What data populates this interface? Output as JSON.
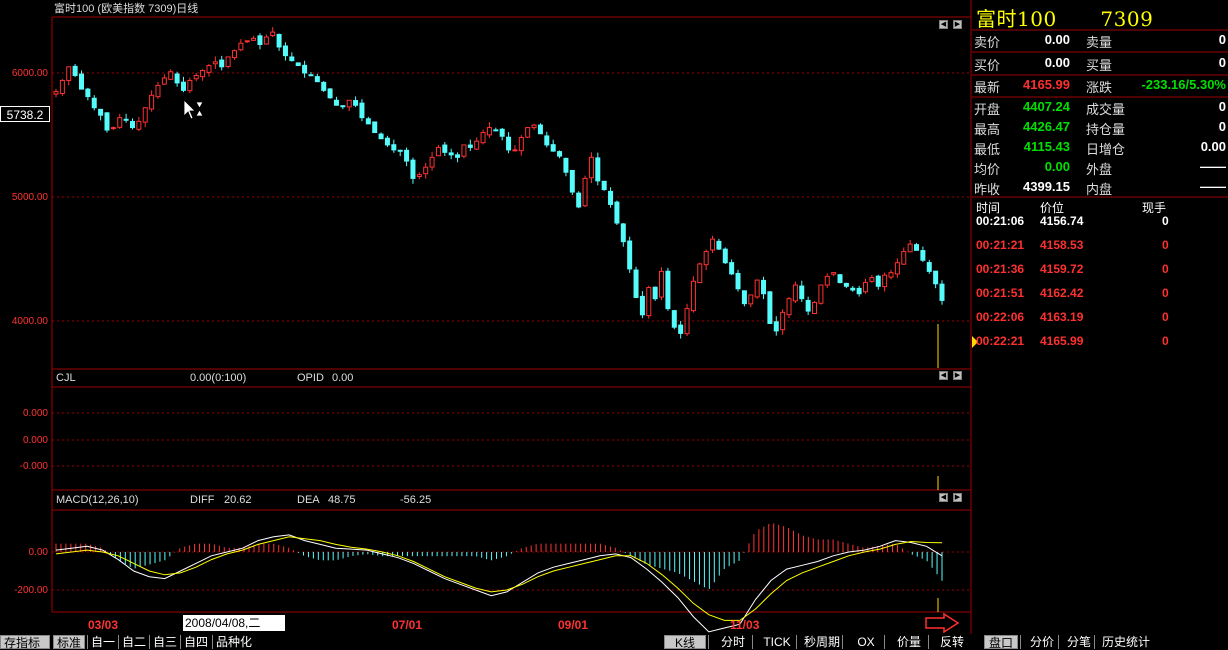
{
  "title": "富时100  (欧美指数  7309)日线",
  "panels": {
    "price": {
      "y_ticks": [
        "6000.00",
        "5000.00",
        "4000.00"
      ],
      "cursor_price": "5738.2"
    },
    "cjl": {
      "name": "CJL",
      "value": "0.00(0:100)",
      "opid_label": "OPID",
      "opid_value": "0.00",
      "y_ticks": [
        "0.000",
        "0.000",
        "-0.000"
      ]
    },
    "macd": {
      "name": "MACD(12,26,10)",
      "diff_label": "DIFF",
      "diff_value": "20.62",
      "dea_label": "DEA",
      "dea_value": "48.75",
      "macd_value": "-56.25",
      "y_ticks": [
        "0.00",
        "-200.00"
      ]
    }
  },
  "x_axis": {
    "labels": [
      "03/03",
      "07/01",
      "09/01",
      "11/03"
    ],
    "cursor_date": "2008/04/08,二"
  },
  "quote": {
    "name": "富时100",
    "code": "7309",
    "rows": [
      {
        "l1": "卖价",
        "v1": "0.00",
        "l2": "卖量",
        "v2": "0"
      },
      {
        "l1": "买价",
        "v1": "0.00",
        "l2": "买量",
        "v2": "0"
      },
      {
        "l1": "最新",
        "v1": "4165.99",
        "l2": "涨跌",
        "v2": "-233.16/5.30%"
      },
      {
        "l1": "开盘",
        "v1": "4407.24",
        "l2": "成交量",
        "v2": "0"
      },
      {
        "l1": "最高",
        "v1": "4426.47",
        "l2": "持仓量",
        "v2": "0"
      },
      {
        "l1": "最低",
        "v1": "4115.43",
        "l2": "日增仓",
        "v2": "0.00"
      },
      {
        "l1": "均价",
        "v1": "0.00",
        "l2": "外盘",
        "v2": "——"
      },
      {
        "l1": "昨收",
        "v1": "4399.15",
        "l2": "内盘",
        "v2": "——"
      }
    ],
    "ticks_header": {
      "time": "时间",
      "price": "价位",
      "vol": "现手"
    },
    "ticks": [
      {
        "time": "00:21:06",
        "price": "4156.74",
        "vol": "0"
      },
      {
        "time": "00:21:21",
        "price": "4158.53",
        "vol": "0"
      },
      {
        "time": "00:21:36",
        "price": "4159.72",
        "vol": "0"
      },
      {
        "time": "00:21:51",
        "price": "4162.42",
        "vol": "0"
      },
      {
        "time": "00:22:06",
        "price": "4163.19",
        "vol": "0"
      },
      {
        "time": "00:22:21",
        "price": "4165.99",
        "vol": "0"
      }
    ]
  },
  "bottom_tabs_left": [
    "存指标",
    "标准",
    "自一",
    "自二",
    "自三",
    "自四",
    "品种化"
  ],
  "bottom_tabs_mid": [
    "K线",
    "分时",
    "TICK",
    "秒周期",
    "OX",
    "价量",
    "反转"
  ],
  "bottom_tabs_right": [
    "盘口",
    "分价",
    "分笔",
    "历史统计"
  ],
  "colors": {
    "up": "#ff3232",
    "down": "#54fcfc",
    "grid": "#a00000",
    "diff": "#ffffff",
    "dea": "#ffff00"
  },
  "chart_data": {
    "type": "candlestick",
    "title": "",
    "x_labels": [
      "03/03",
      "07/01",
      "09/01",
      "11/03"
    ],
    "ylim": [
      3650,
      6400
    ],
    "y_ticks": [
      6000,
      5000,
      4000
    ],
    "closes": [
      5850,
      5940,
      6050,
      5980,
      5870,
      5810,
      5720,
      5660,
      5540,
      5560,
      5640,
      5620,
      5560,
      5610,
      5720,
      5820,
      5900,
      5960,
      6010,
      5920,
      5860,
      5940,
      5980,
      6020,
      6060,
      6090,
      6050,
      6130,
      6180,
      6240,
      6260,
      6280,
      6230,
      6290,
      6330,
      6210,
      6140,
      6100,
      6060,
      6000,
      5980,
      5930,
      5860,
      5800,
      5740,
      5730,
      5780,
      5740,
      5640,
      5590,
      5520,
      5470,
      5420,
      5380,
      5370,
      5290,
      5150,
      5180,
      5240,
      5320,
      5400,
      5360,
      5340,
      5320,
      5420,
      5400,
      5450,
      5520,
      5560,
      5540,
      5490,
      5380,
      5380,
      5480,
      5560,
      5580,
      5510,
      5420,
      5370,
      5330,
      5200,
      5040,
      4920,
      5150,
      5320,
      5130,
      5060,
      4940,
      4790,
      4640,
      4420,
      4190,
      4050,
      4270,
      4180,
      4400,
      4100,
      3950,
      3900,
      4100,
      4320,
      4460,
      4560,
      4660,
      4580,
      4470,
      4380,
      4260,
      4140,
      4210,
      4330,
      4220,
      3980,
      3920,
      4070,
      4180,
      4290,
      4180,
      4080,
      4150,
      4290,
      4360,
      4390,
      4310,
      4280,
      4250,
      4220,
      4310,
      4350,
      4280,
      4370,
      4390,
      4470,
      4560,
      4620,
      4570,
      4490,
      4400,
      4300,
      4165.99
    ],
    "volume_series": [
      {
        "name": "CJL",
        "values": [
          0
        ]
      }
    ],
    "macd": {
      "series": [
        {
          "name": "DIFF",
          "values": [
            10,
            20,
            30,
            10,
            -40,
            -100,
            -130,
            -140,
            -100,
            -60,
            -20,
            0,
            20,
            60,
            80,
            90,
            60,
            40,
            20,
            15,
            10,
            -10,
            -30,
            -60,
            -100,
            -140,
            -170,
            -200,
            -230,
            -210,
            -160,
            -110,
            -80,
            -60,
            -40,
            -20,
            -10,
            -30,
            -90,
            -160,
            -240,
            -340,
            -420,
            -400,
            -380,
            -250,
            -150,
            -90,
            -70,
            -50,
            -20,
            0,
            10,
            30,
            60,
            50,
            30,
            -20
          ]
        },
        {
          "name": "DEA",
          "values": [
            -10,
            0,
            10,
            0,
            -20,
            -60,
            -100,
            -120,
            -110,
            -80,
            -40,
            -10,
            10,
            40,
            60,
            80,
            70,
            60,
            40,
            25,
            15,
            0,
            -20,
            -50,
            -90,
            -130,
            -160,
            -190,
            -210,
            -200,
            -170,
            -130,
            -100,
            -80,
            -60,
            -40,
            -20,
            -20,
            -60,
            -120,
            -190,
            -270,
            -330,
            -360,
            -360,
            -300,
            -220,
            -150,
            -110,
            -80,
            -50,
            -20,
            0,
            15,
            40,
            55,
            50,
            48.75
          ]
        }
      ],
      "ylim": [
        -320,
        120
      ]
    }
  }
}
